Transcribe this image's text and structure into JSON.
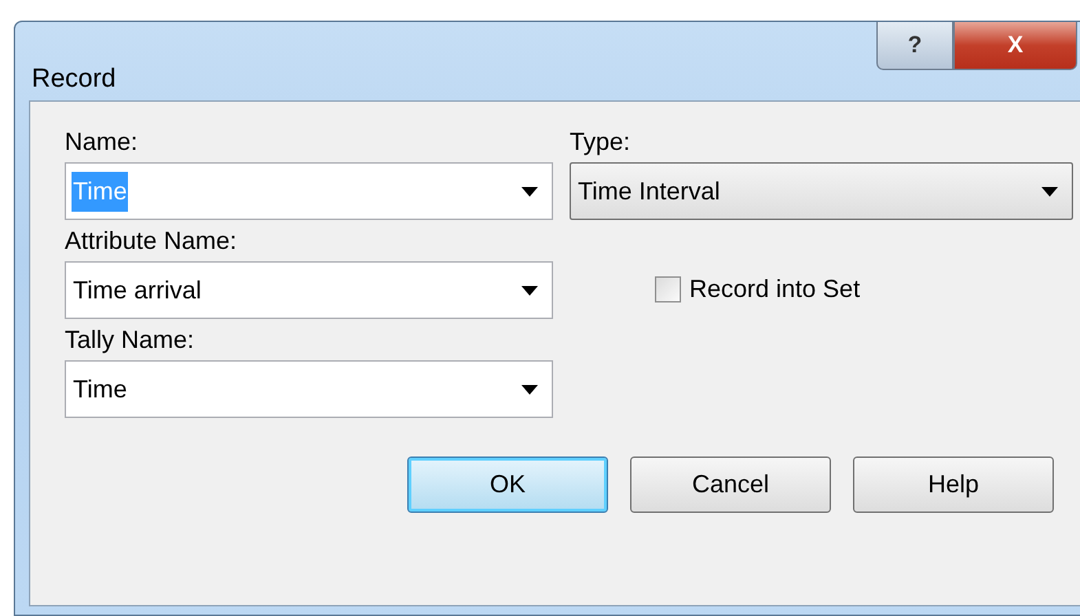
{
  "window": {
    "title": "Record",
    "help_button": "?",
    "close_button": "X"
  },
  "name_field": {
    "label": "Name:",
    "value": "Time",
    "text_selected": true,
    "kind": "editable"
  },
  "type_field": {
    "label": "Type:",
    "value": "Time Interval",
    "kind": "list"
  },
  "attribute_field": {
    "label": "Attribute Name:",
    "value": "Time arrival",
    "kind": "editable"
  },
  "record_into_set": {
    "label": "Record into Set",
    "checked": false
  },
  "tally_field": {
    "label": "Tally Name:",
    "value": "Time",
    "kind": "editable"
  },
  "buttons": [
    {
      "label": "OK",
      "default": true
    },
    {
      "label": "Cancel",
      "default": false
    },
    {
      "label": "Help",
      "default": false
    }
  ]
}
